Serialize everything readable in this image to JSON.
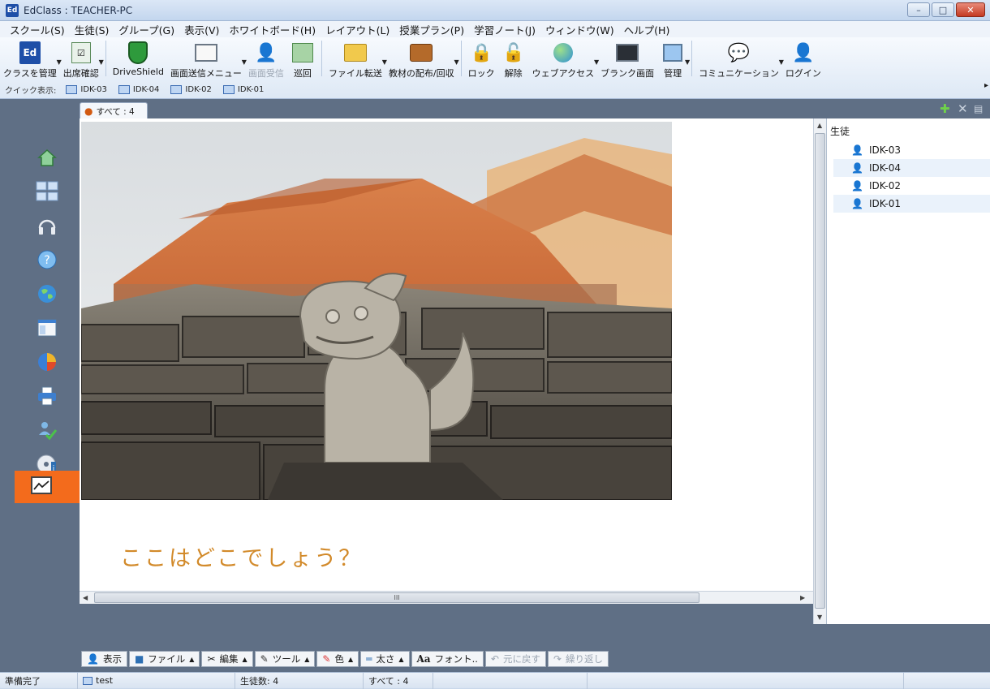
{
  "window": {
    "app_icon": "Ed",
    "title": "EdClass : TEACHER-PC",
    "minimize": "–",
    "maximize": "□",
    "close": "✕"
  },
  "menu": [
    "スクール(S)",
    "生徒(S)",
    "グループ(G)",
    "表示(V)",
    "ホワイトボード(H)",
    "レイアウト(L)",
    "授業プラン(P)",
    "学習ノート(J)",
    "ウィンドウ(W)",
    "ヘルプ(H)"
  ],
  "toolbar": {
    "class_manage": "クラスを管理",
    "attendance": "出席確認",
    "driveshield": "DriveShield",
    "screen_send": "画面送信メニュー",
    "screen_receive": "画面受信",
    "patrol": "巡回",
    "file_transfer": "ファイル転送",
    "material_distribute": "教材の配布/回収",
    "lock": "ロック",
    "unlock": "解除",
    "web_access": "ウェブアクセス",
    "blank_screen": "ブランク画面",
    "manage": "管理",
    "communication": "コミュニケーション",
    "login": "ログイン",
    "more": "▸"
  },
  "quick_view": {
    "label": "クイック表示:",
    "items": [
      "IDK-03",
      "IDK-04",
      "IDK-02",
      "IDK-01"
    ]
  },
  "tab": {
    "label": "すべて : 4"
  },
  "right_panel": {
    "header": "生徒",
    "students": [
      "IDK-03",
      "IDK-04",
      "IDK-02",
      "IDK-01"
    ]
  },
  "canvas": {
    "caption": "ここはどこでしょう？",
    "hscroll_grip": "III"
  },
  "drawbar": {
    "view": "表示",
    "file": "ファイル",
    "edit": "編集",
    "tool": "ツール",
    "color": "色",
    "thickness": "太さ",
    "font": "フォント..",
    "undo": "元に戻す",
    "redo": "繰り返し"
  },
  "status": {
    "ready": "準備完了",
    "class_name": "test",
    "student_count": "生徒数: 4",
    "all_count": "すべて : 4"
  }
}
